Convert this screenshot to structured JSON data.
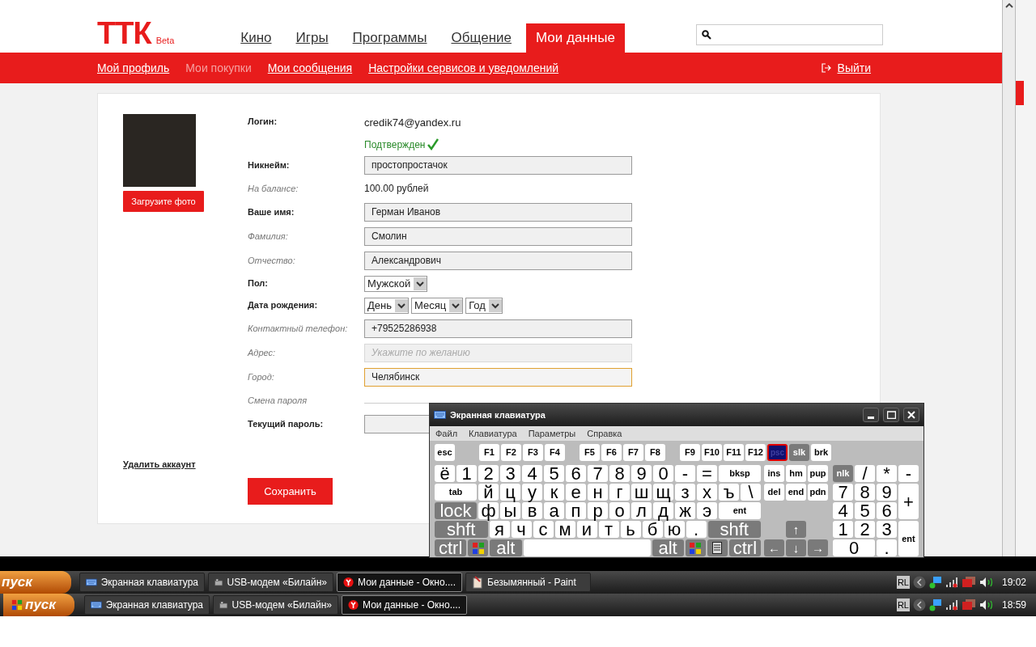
{
  "header": {
    "logo": "ТТК",
    "badge": "Beta",
    "nav": [
      {
        "label": "Кино",
        "selected": false
      },
      {
        "label": "Игры",
        "selected": false
      },
      {
        "label": "Программы",
        "selected": false
      },
      {
        "label": "Общение",
        "selected": false
      },
      {
        "label": "Мои данные",
        "selected": true
      }
    ]
  },
  "subnav": {
    "items": [
      {
        "label": "Мой профиль",
        "disabled": false
      },
      {
        "label": "Мои покупки",
        "disabled": true
      },
      {
        "label": "Мои сообщения",
        "disabled": false
      },
      {
        "label": "Настройки сервисов и уведомлений",
        "disabled": false
      }
    ],
    "logout": "Выйти"
  },
  "profile": {
    "upload_button": "Загрузите фото",
    "delete_link": "Удалить аккаунт",
    "save_button": "Сохранить",
    "rows": [
      {
        "kind": "login",
        "label": "Логин:",
        "emphasized": true,
        "value": "credik74@yandex.ru",
        "status": "Подтвержден"
      },
      {
        "kind": "input",
        "label": "Никнейм:",
        "emphasized": true,
        "value": "простопростачок",
        "focused": false
      },
      {
        "kind": "text",
        "label": "На балансе:",
        "emphasized": false,
        "value": "100.00 рублей"
      },
      {
        "kind": "input",
        "label": "Ваше имя:",
        "emphasized": true,
        "value": "Герман Иванов",
        "focused": false
      },
      {
        "kind": "input",
        "label": "Фамилия:",
        "emphasized": false,
        "value": "Смолин",
        "focused": false
      },
      {
        "kind": "input",
        "label": "Отчество:",
        "emphasized": false,
        "value": "Александрович",
        "focused": false
      },
      {
        "kind": "selects",
        "label": "Пол:",
        "emphasized": true,
        "selects": [
          "Мужской"
        ]
      },
      {
        "kind": "selects",
        "label": "Дата рождения:",
        "emphasized": true,
        "selects": [
          "День",
          "Месяц",
          "Год"
        ]
      },
      {
        "kind": "input",
        "label": "Контактный телефон:",
        "emphasized": false,
        "value": "+79525286938",
        "focused": false
      },
      {
        "kind": "input",
        "label": "Адрес:",
        "emphasized": false,
        "placeholder": "Укажите по желанию",
        "focused": false
      },
      {
        "kind": "input",
        "label": "Город:",
        "emphasized": false,
        "value": "Челябинск",
        "focused": true
      },
      {
        "kind": "section",
        "label": "Смена пароля",
        "emphasized": false
      },
      {
        "kind": "input",
        "label": "Текущий пароль:",
        "emphasized": true,
        "focused": false
      }
    ]
  },
  "keyboard": {
    "title": "Экранная клавиатура",
    "menu": [
      "Файл",
      "Клавиатура",
      "Параметры",
      "Справка"
    ],
    "function_groups": [
      [
        {
          "label": "esc",
          "kind": "fkey"
        }
      ],
      [
        {
          "label": "F1",
          "kind": "fkey"
        },
        {
          "label": "F2",
          "kind": "fkey"
        },
        {
          "label": "F3",
          "kind": "fkey"
        },
        {
          "label": "F4",
          "kind": "fkey"
        }
      ],
      [
        {
          "label": "F5",
          "kind": "fkey"
        },
        {
          "label": "F6",
          "kind": "fkey"
        },
        {
          "label": "F7",
          "kind": "fkey"
        },
        {
          "label": "F8",
          "kind": "fkey"
        }
      ],
      [
        {
          "label": "F9",
          "kind": "fkey"
        },
        {
          "label": "F10",
          "kind": "fkey"
        },
        {
          "label": "F11",
          "kind": "fkey"
        },
        {
          "label": "F12",
          "kind": "fkey"
        },
        {
          "label": "psc",
          "kind": "pressed"
        },
        {
          "label": "slk",
          "kind": "toggle"
        },
        {
          "label": "brk",
          "kind": "fkey"
        }
      ]
    ],
    "main_rows": [
      [
        {
          "label": "ё",
          "kind": "key"
        },
        {
          "label": "1",
          "kind": "key"
        },
        {
          "label": "2",
          "kind": "key"
        },
        {
          "label": "3",
          "kind": "key"
        },
        {
          "label": "4",
          "kind": "key"
        },
        {
          "label": "5",
          "kind": "key"
        },
        {
          "label": "6",
          "kind": "key"
        },
        {
          "label": "7",
          "kind": "key"
        },
        {
          "label": "8",
          "kind": "key"
        },
        {
          "label": "9",
          "kind": "key"
        },
        {
          "label": "0",
          "kind": "key"
        },
        {
          "label": "-",
          "kind": "key"
        },
        {
          "label": "=",
          "kind": "key"
        },
        {
          "label": "bksp",
          "kind": "wide"
        }
      ],
      [
        {
          "label": "tab",
          "kind": "wide"
        },
        {
          "label": "й",
          "kind": "key"
        },
        {
          "label": "ц",
          "kind": "key"
        },
        {
          "label": "у",
          "kind": "key"
        },
        {
          "label": "к",
          "kind": "key"
        },
        {
          "label": "е",
          "kind": "key"
        },
        {
          "label": "н",
          "kind": "key"
        },
        {
          "label": "г",
          "kind": "key"
        },
        {
          "label": "ш",
          "kind": "key"
        },
        {
          "label": "щ",
          "kind": "key"
        },
        {
          "label": "з",
          "kind": "key"
        },
        {
          "label": "х",
          "kind": "key"
        },
        {
          "label": "ъ",
          "kind": "key"
        },
        {
          "label": "\\",
          "kind": "key"
        }
      ],
      [
        {
          "label": "lock",
          "kind": "mod"
        },
        {
          "label": "ф",
          "kind": "key"
        },
        {
          "label": "ы",
          "kind": "key"
        },
        {
          "label": "в",
          "kind": "key"
        },
        {
          "label": "а",
          "kind": "key"
        },
        {
          "label": "п",
          "kind": "key"
        },
        {
          "label": "р",
          "kind": "key"
        },
        {
          "label": "о",
          "kind": "key"
        },
        {
          "label": "л",
          "kind": "key"
        },
        {
          "label": "д",
          "kind": "key"
        },
        {
          "label": "ж",
          "kind": "key"
        },
        {
          "label": "э",
          "kind": "key"
        },
        {
          "label": "ent",
          "kind": "wide"
        }
      ],
      [
        {
          "label": "shft",
          "kind": "mod"
        },
        {
          "label": "я",
          "kind": "key"
        },
        {
          "label": "ч",
          "kind": "key"
        },
        {
          "label": "с",
          "kind": "key"
        },
        {
          "label": "м",
          "kind": "key"
        },
        {
          "label": "и",
          "kind": "key"
        },
        {
          "label": "т",
          "kind": "key"
        },
        {
          "label": "ь",
          "kind": "key"
        },
        {
          "label": "б",
          "kind": "key"
        },
        {
          "label": "ю",
          "kind": "key"
        },
        {
          "label": ".",
          "kind": "key"
        },
        {
          "label": "shft",
          "kind": "mod"
        }
      ],
      [
        {
          "label": "ctrl",
          "kind": "mod"
        },
        {
          "kind": "logo"
        },
        {
          "label": "alt",
          "kind": "mod"
        },
        {
          "kind": "space"
        },
        {
          "label": "alt",
          "kind": "mod"
        },
        {
          "kind": "logo"
        },
        {
          "kind": "menu"
        },
        {
          "label": "ctrl",
          "kind": "mod"
        }
      ]
    ],
    "nav_keys": [
      {
        "label": "ins",
        "kind": "fkey"
      },
      {
        "label": "hm",
        "kind": "fkey"
      },
      {
        "label": "pup",
        "kind": "fkey"
      },
      {
        "label": "del",
        "kind": "fkey"
      },
      {
        "label": "end",
        "kind": "fkey"
      },
      {
        "label": "pdn",
        "kind": "fkey"
      },
      {
        "label": "↑",
        "kind": "up"
      },
      {
        "label": "←",
        "kind": "arrow"
      },
      {
        "label": "↓",
        "kind": "arrow"
      },
      {
        "label": "→",
        "kind": "arrow"
      }
    ],
    "numpad": [
      {
        "label": "nlk",
        "kind": "toggle"
      },
      {
        "label": "/",
        "kind": "key"
      },
      {
        "label": "*",
        "kind": "key"
      },
      {
        "label": "-",
        "kind": "key"
      },
      {
        "label": "7",
        "kind": "key"
      },
      {
        "label": "8",
        "kind": "key"
      },
      {
        "label": "9",
        "kind": "key"
      },
      {
        "label": "+",
        "kind": "tall"
      },
      {
        "label": "4",
        "kind": "key"
      },
      {
        "label": "5",
        "kind": "key"
      },
      {
        "label": "6",
        "kind": "key"
      },
      {
        "label": "1",
        "kind": "key"
      },
      {
        "label": "2",
        "kind": "key"
      },
      {
        "label": "3",
        "kind": "key"
      },
      {
        "label": "ent",
        "kind": "tall-small"
      },
      {
        "label": "0",
        "kind": "double"
      },
      {
        "label": ".",
        "kind": "key"
      }
    ]
  },
  "taskbars": [
    {
      "start": "пуск",
      "items": [
        {
          "label": "Экранная клавиатура",
          "kind": "keyboard",
          "selected": false
        },
        {
          "label": "USB-модем «Билайн»",
          "kind": "modem",
          "selected": false
        },
        {
          "label": "Мои данные - Окно....",
          "kind": "browser",
          "selected": true
        },
        {
          "label": "Безымянный - Paint",
          "kind": "paint",
          "selected": false
        }
      ],
      "language": "RL",
      "time": "19:02"
    },
    {
      "start": "пуск",
      "items": [
        {
          "label": "Экранная клавиатура",
          "kind": "keyboard",
          "selected": false
        },
        {
          "label": "USB-модем «Билайн»",
          "kind": "modem",
          "selected": false
        },
        {
          "label": "Мои данные - Окно....",
          "kind": "browser",
          "selected": true
        }
      ],
      "language": "RL",
      "time": "18:59"
    }
  ]
}
